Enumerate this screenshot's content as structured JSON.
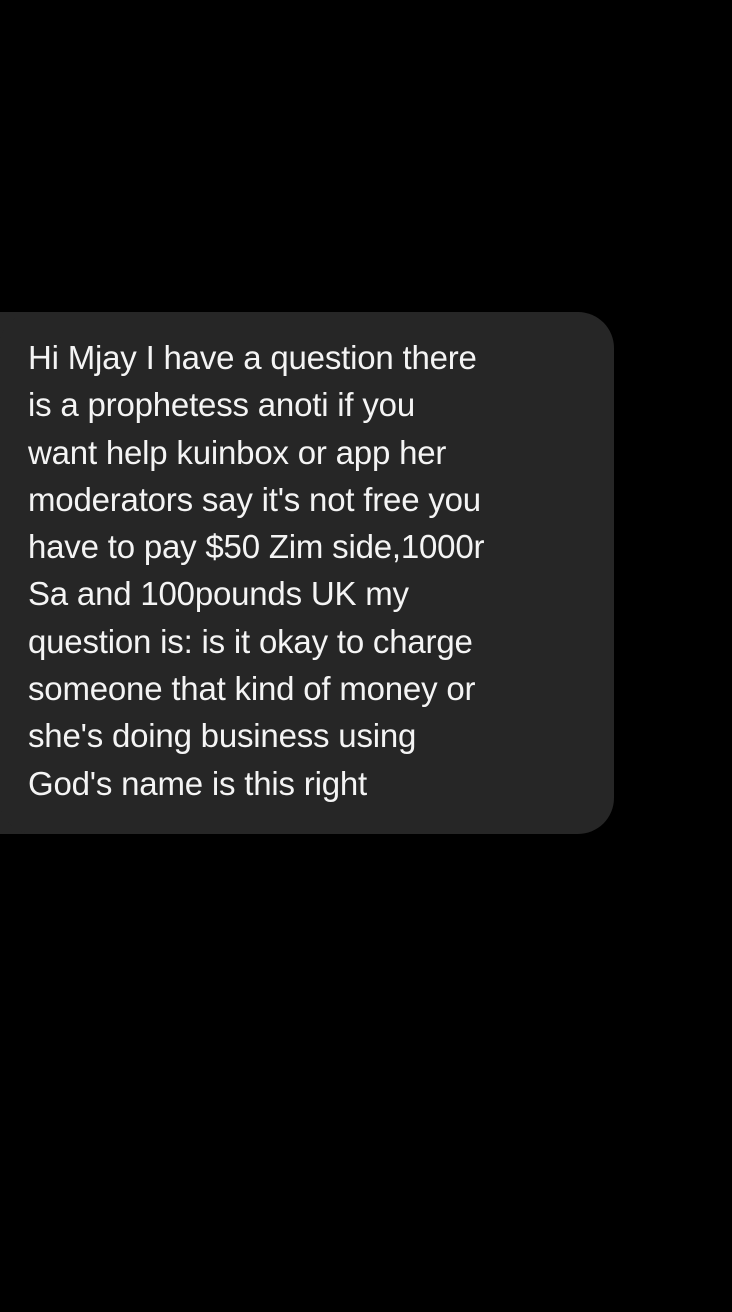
{
  "message": {
    "lines": [
      "Hi Mjay I have a question there",
      "is a prophetess anoti if you",
      "want help kuinbox or app her",
      "moderators say it's not free you",
      "have to pay $50 Zim side,1000r",
      "Sa and 100pounds UK my",
      "question is: is it okay to charge",
      "someone that kind of money or",
      "she's doing business using",
      "God's name is this right"
    ]
  },
  "colors": {
    "background": "#000000",
    "bubble": "#262626",
    "text": "#f4f4f4"
  }
}
